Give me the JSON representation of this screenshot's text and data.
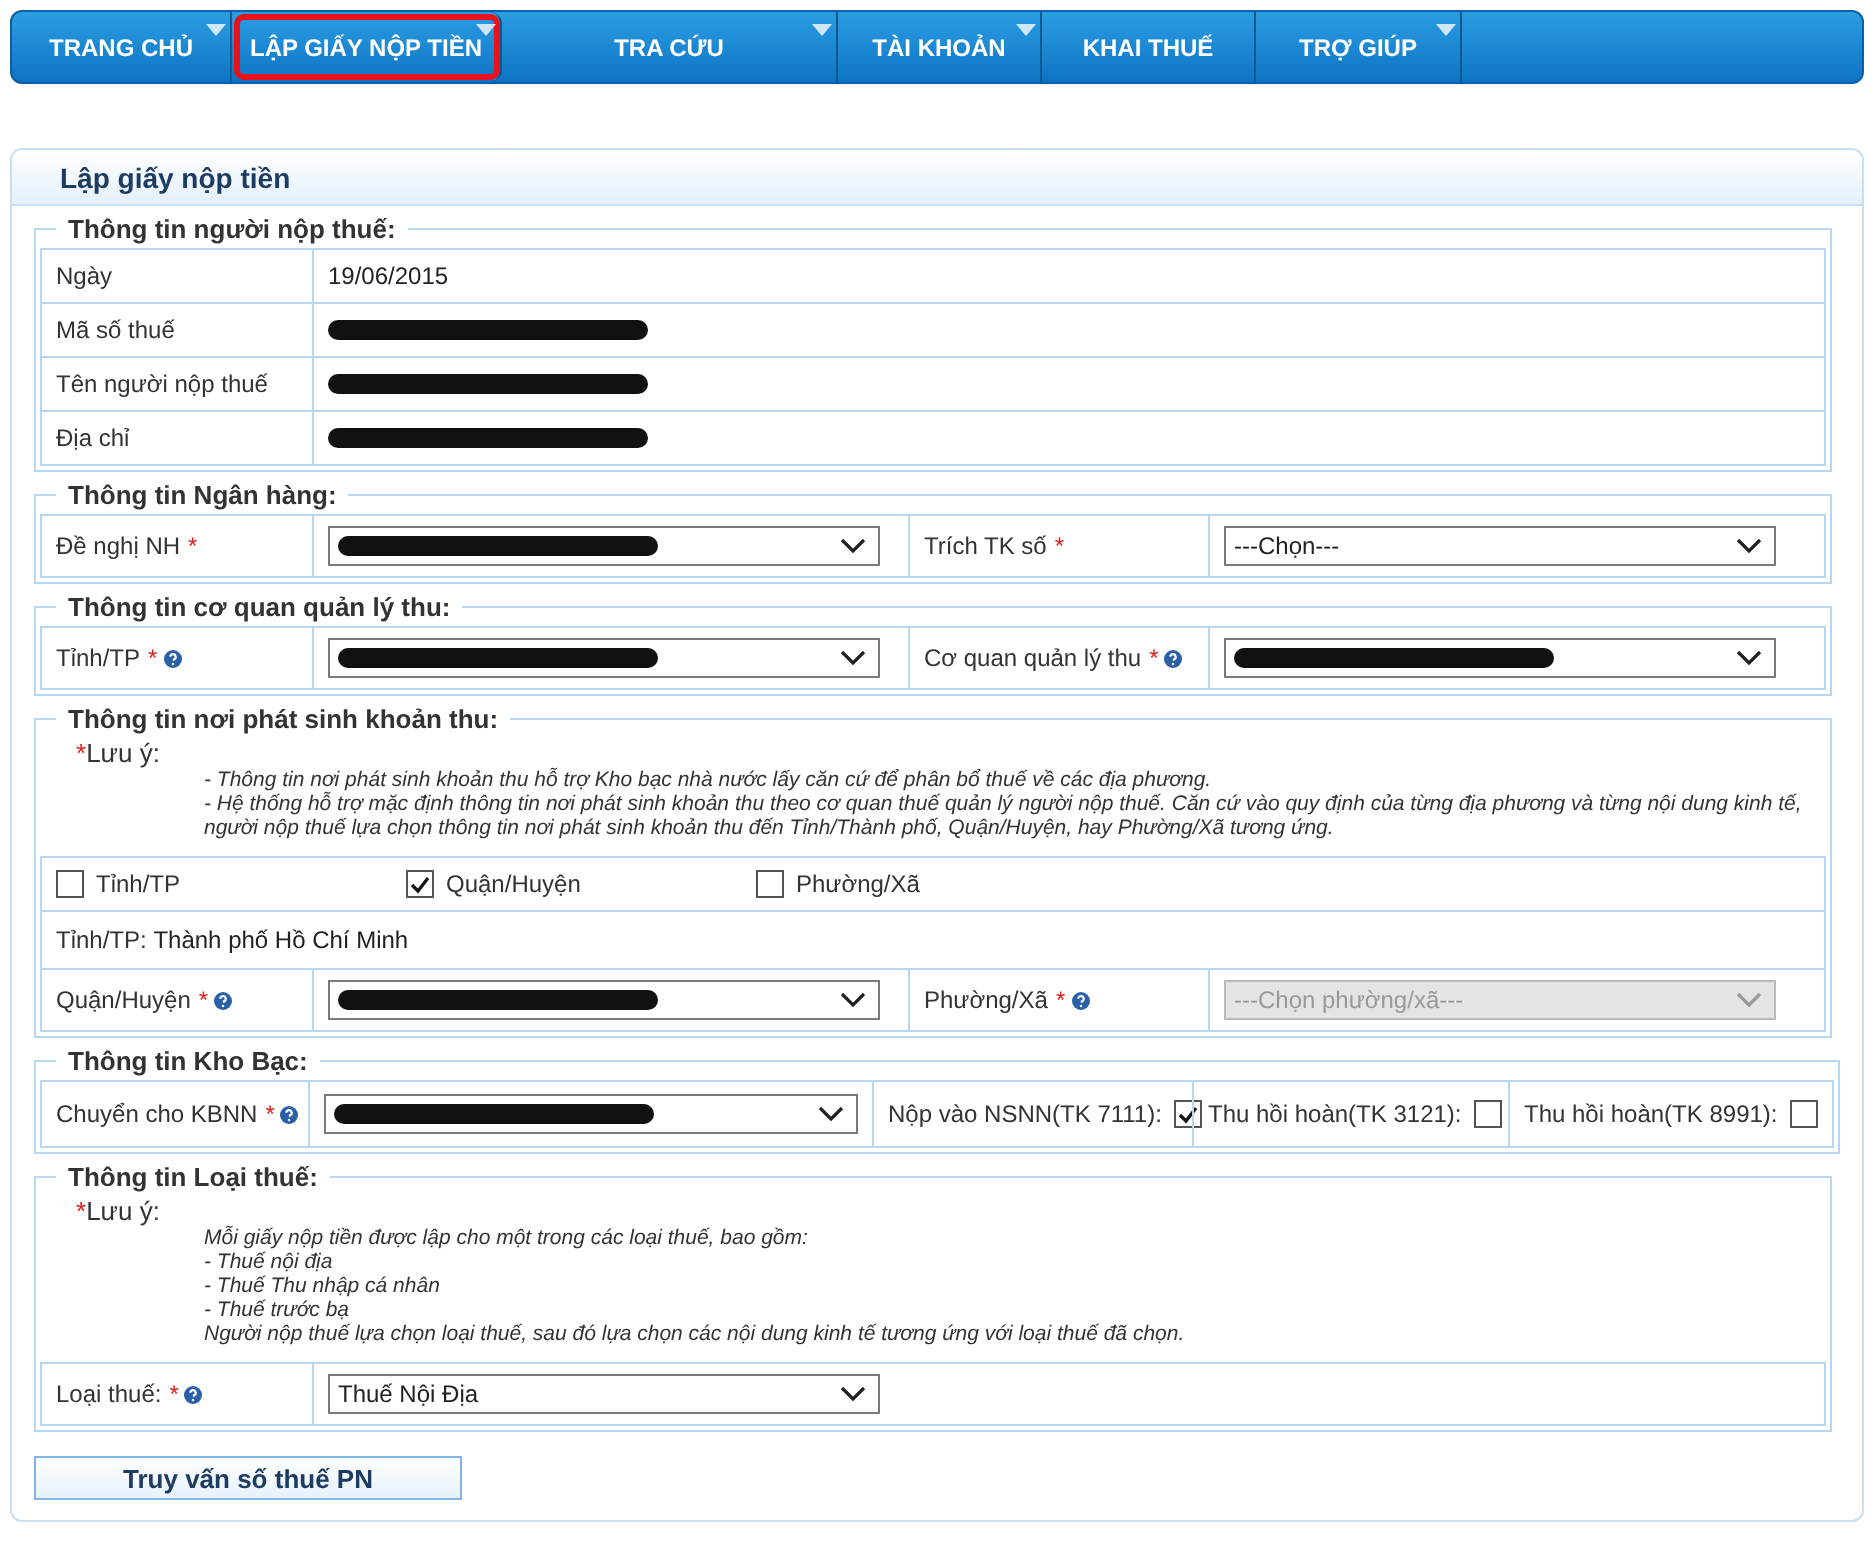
{
  "nav": [
    {
      "label": "TRANG CHỦ",
      "has_menu": true,
      "highlighted": false
    },
    {
      "label": "LẬP GIẤY NỘP TIỀN",
      "has_menu": true,
      "highlighted": true
    },
    {
      "label": "TRA CỨU",
      "has_menu": true,
      "highlighted": false
    },
    {
      "label": "TÀI KHOẢN",
      "has_menu": true,
      "highlighted": false
    },
    {
      "label": "KHAI THUẾ",
      "has_menu": false,
      "highlighted": false
    },
    {
      "label": "TRỢ GIÚP",
      "has_menu": true,
      "highlighted": false
    }
  ],
  "page_title": "Lập giấy nộp tiền",
  "sections": [
    {
      "title": "Thông tin người nộp thuế:",
      "rows": [
        {
          "kind": "info",
          "label": "Ngày",
          "value": "19/06/2015",
          "redacted": false
        },
        {
          "kind": "info",
          "label": "Mã số thuế",
          "redacted": true
        },
        {
          "kind": "info",
          "label": "Tên người nộp thuế",
          "redacted": true
        },
        {
          "kind": "info",
          "label": "Địa chỉ",
          "redacted": true
        }
      ]
    },
    {
      "title": "Thông tin Ngân hàng:",
      "rows": [
        {
          "kind": "fields",
          "fields": [
            {
              "label": "Đề nghị NH",
              "required_mark": "*",
              "help": false,
              "select": {
                "redacted": true,
                "disabled": false
              }
            },
            {
              "label": "Trích TK số",
              "required_mark": "*",
              "help": false,
              "select": {
                "value": "---Chọn---",
                "redacted": false,
                "disabled": false
              }
            }
          ]
        }
      ]
    },
    {
      "title": "Thông tin cơ quan quản lý thu:",
      "rows": [
        {
          "kind": "fields",
          "fields": [
            {
              "label": "Tỉnh/TP",
              "required_mark": "*",
              "help": true,
              "select": {
                "redacted": true,
                "disabled": false
              }
            },
            {
              "label": "Cơ quan quản lý thu",
              "required_mark": "*",
              "help": true,
              "select": {
                "redacted": true,
                "disabled": false
              }
            }
          ]
        }
      ]
    },
    {
      "title": "Thông tin nơi phát sinh khoản thu:",
      "note": {
        "mark": "*",
        "label": "Lưu ý:",
        "lines": [
          "- Thông tin nơi phát sinh khoản thu hỗ trợ Kho bạc nhà nước lấy căn cứ để phân bổ thuế về các địa phương.",
          "- Hệ thống hỗ trợ mặc định thông tin nơi phát sinh khoản thu theo cơ quan thuế quản lý người nộp thuế. Căn cứ vào quy định của từng địa phương và từng nội dung kinh tế, người nộp thuế lựa chọn thông tin nơi phát sinh khoản thu đến Tỉnh/Thành phố, Quận/Huyện, hay Phường/Xã tương ứng."
        ]
      },
      "rows": [
        {
          "kind": "checks",
          "items": [
            {
              "label": "Tỉnh/TP",
              "checked": false
            },
            {
              "label": "Quận/Huyện",
              "checked": true
            },
            {
              "label": "Phường/Xã",
              "checked": false
            }
          ]
        },
        {
          "kind": "text",
          "label": "Tỉnh/TP:",
          "value": "Thành phố Hồ Chí Minh"
        },
        {
          "kind": "fields",
          "fields": [
            {
              "label": "Quận/Huyện",
              "required_mark": "*",
              "help": true,
              "select": {
                "redacted": true,
                "disabled": false
              }
            },
            {
              "label": "Phường/Xã",
              "required_mark": "*",
              "help": true,
              "select": {
                "value": "---Chọn phường/xã---",
                "redacted": false,
                "disabled": true
              }
            }
          ]
        }
      ]
    },
    {
      "title": "Thông tin Kho Bạc:",
      "rows": [
        {
          "kind": "treasury",
          "field": {
            "label": "Chuyển cho KBNN",
            "required_mark": "*",
            "help": true,
            "select": {
              "redacted": true,
              "disabled": false
            }
          },
          "flags": [
            {
              "label": "Nộp vào NSNN(TK 7111):",
              "checked": true
            },
            {
              "label": "Thu hồi hoàn(TK 3121):",
              "checked": false
            },
            {
              "label": "Thu hồi hoàn(TK 8991):",
              "checked": false
            }
          ]
        }
      ]
    },
    {
      "title": "Thông tin Loại thuế:",
      "note": {
        "mark": "*",
        "label": "Lưu ý:",
        "lines": [
          "Mỗi giấy nộp tiền được lập cho một trong các loại thuế, bao gồm:",
          "- Thuế nội địa",
          "- Thuế Thu nhập cá nhân",
          "- Thuế trước bạ",
          "Người nộp thuế lựa chọn loại thuế, sau đó lựa chọn các nội dung kinh tế tương ứng với loại thuế đã chọn."
        ]
      },
      "rows": [
        {
          "kind": "fields",
          "fields": [
            {
              "label": "Loại thuế:",
              "required_mark": "*",
              "help": true,
              "select": {
                "value": "Thuế Nội Địa",
                "redacted": false,
                "disabled": false
              }
            }
          ]
        }
      ]
    }
  ],
  "query_button": "Truy vấn số thuế PN"
}
